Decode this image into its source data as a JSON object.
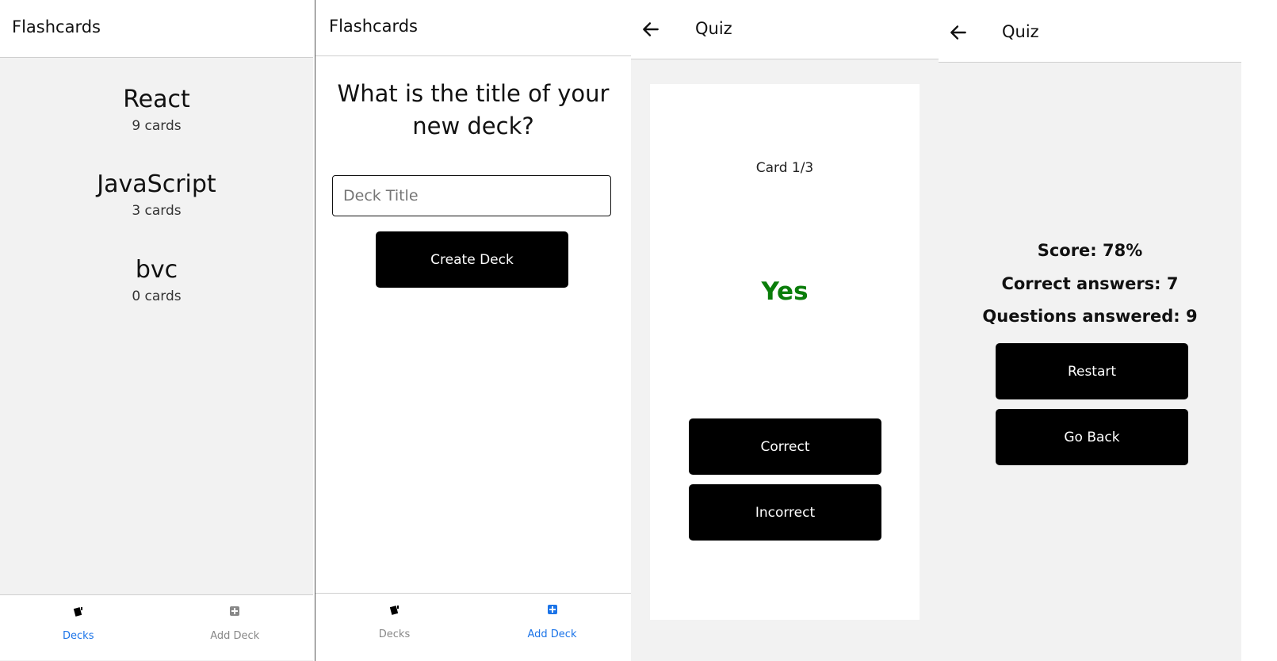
{
  "screen1": {
    "title": "Flashcards",
    "decks": [
      {
        "title": "React",
        "count": "9 cards"
      },
      {
        "title": "JavaScript",
        "count": "3 cards"
      },
      {
        "title": "bvc",
        "count": "0 cards"
      }
    ],
    "tabs": [
      {
        "label": "Decks",
        "icon": "cards-icon",
        "active": true
      },
      {
        "label": "Add Deck",
        "icon": "plus-square-icon",
        "active": false
      }
    ]
  },
  "screen2": {
    "title": "Flashcards",
    "question": "What is the title of your new deck?",
    "input": {
      "placeholder": "Deck Title",
      "value": ""
    },
    "create_label": "Create Deck",
    "tabs": [
      {
        "label": "Decks",
        "icon": "cards-icon",
        "active": false
      },
      {
        "label": "Add Deck",
        "icon": "plus-square-icon",
        "active": true
      }
    ]
  },
  "screen3": {
    "title": "Quiz",
    "progress": "Card 1/3",
    "answer": "Yes",
    "correct_label": "Correct",
    "incorrect_label": "Incorrect"
  },
  "screen4": {
    "title": "Quiz",
    "score": "Score: 78%",
    "correct": "Correct answers: 7",
    "answered": "Questions answered: 9",
    "restart_label": "Restart",
    "goback_label": "Go Back"
  },
  "colors": {
    "accent": "#1a73e8",
    "inactive": "#888888",
    "answer": "#0a7d0a",
    "bg": "#f2f2f2"
  }
}
